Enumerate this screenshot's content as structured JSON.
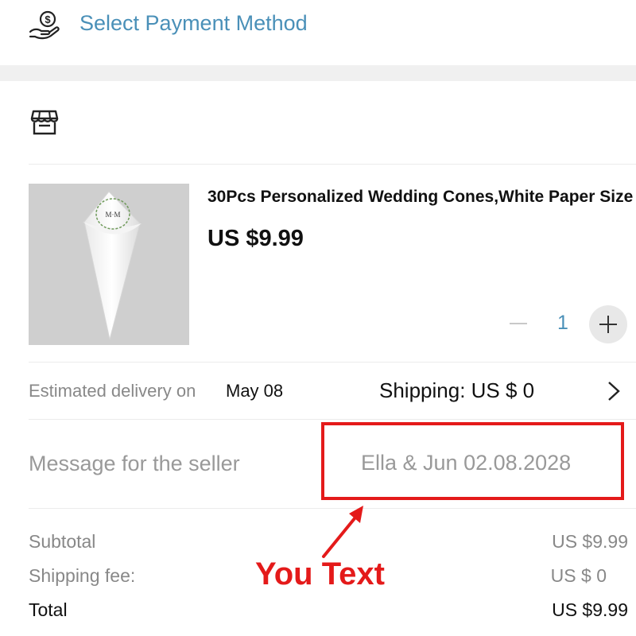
{
  "header": {
    "title": "Select Payment Method",
    "icon": "hand-coin-icon"
  },
  "store": {
    "icon": "store-icon"
  },
  "product": {
    "name": "30Pcs Personalized Wedding Cones,White Paper Size",
    "price": "US $9.99",
    "image_monogram": "M·M",
    "quantity": "1",
    "qty_minus_icon": "minus-icon",
    "qty_plus_icon": "plus-icon"
  },
  "delivery": {
    "label": "Estimated delivery on",
    "date": "May 08",
    "shipping": "Shipping: US $ 0",
    "chevron_icon": "chevron-right-icon"
  },
  "message": {
    "label": "Message for the seller",
    "value": "Ella & Jun 02.08.2028"
  },
  "annotation": {
    "text": "You Text",
    "color": "#e41a1a"
  },
  "summary": {
    "subtotal_label": "Subtotal",
    "subtotal_value": "US $9.99",
    "shipping_fee_label": "Shipping fee:",
    "shipping_fee_value": "US $ 0",
    "total_label": "Total",
    "total_value": "US $9.99"
  },
  "colors": {
    "accent": "#4a90b8",
    "muted_text": "#888888",
    "highlight": "#e41a1a"
  }
}
